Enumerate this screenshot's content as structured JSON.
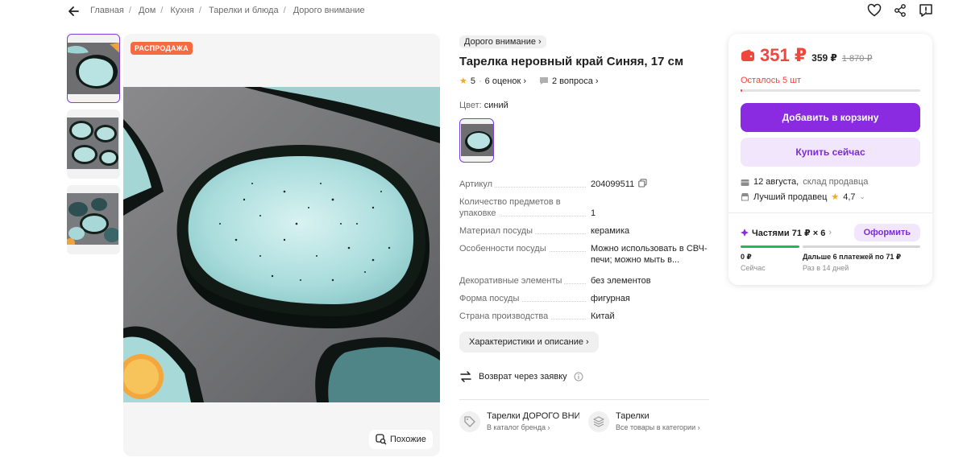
{
  "breadcrumb": {
    "items": [
      "Главная",
      "Дом",
      "Кухня",
      "Тарелки и блюда",
      "Дорого внимание"
    ]
  },
  "gallery": {
    "sale_badge": "РАСПРОДАЖА",
    "similar_label": "Похожие",
    "thumbnail_count": 3
  },
  "product": {
    "brand": "Дорого внимание",
    "title": "Тарелка неровный край Синяя, 17 см",
    "rating": "5",
    "reviews": "6 оценок",
    "questions": "2 вопроса",
    "color_label": "Цвет:",
    "color_value": "синий"
  },
  "specs": [
    {
      "k": "Артикул",
      "v": "204099511"
    },
    {
      "k": "Количество предметов в упаковке",
      "v": "1"
    },
    {
      "k": "Материал посуды",
      "v": "керамика"
    },
    {
      "k": "Особенности посуды",
      "v": "Можно использовать в СВЧ-печи; можно мыть в..."
    },
    {
      "k": "Декоративные элементы",
      "v": "без элементов"
    },
    {
      "k": "Форма посуды",
      "v": "фигурная"
    },
    {
      "k": "Страна производства",
      "v": "Китай"
    }
  ],
  "actions": {
    "characteristics": "Характеристики и описание",
    "return": "Возврат через заявку"
  },
  "links": [
    {
      "title": "Тарелки ДОРОГО ВНИМАНИЕ",
      "sub": "В каталог бренда"
    },
    {
      "title": "Тарелки",
      "sub": "Все товары в категории"
    }
  ],
  "buy": {
    "price": "351 ₽",
    "price_card": "359 ₽",
    "price_old": "1 870 ₽",
    "stock_left": "Осталось 5 шт",
    "stock_fraction": 0.01,
    "add_to_cart": "Добавить в корзину",
    "buy_now": "Купить сейчас",
    "delivery_date": "12 августа,",
    "delivery_where": "склад продавца",
    "seller": "Лучший продавец",
    "seller_rating": "4,7",
    "split_label": "Частями 71 ₽ × 6",
    "split_button": "Оформить",
    "split_now_value": "0 ₽",
    "split_now_sub": "Сейчас",
    "split_later_value": "Дальше 6 платежей по 71 ₽",
    "split_later_sub": "Раз в 14 дней"
  },
  "colors": {
    "accent": "#8a2be2",
    "price_red": "#f1463c",
    "sale_orange": "#f7693e",
    "split_green": "#1fb95b"
  }
}
